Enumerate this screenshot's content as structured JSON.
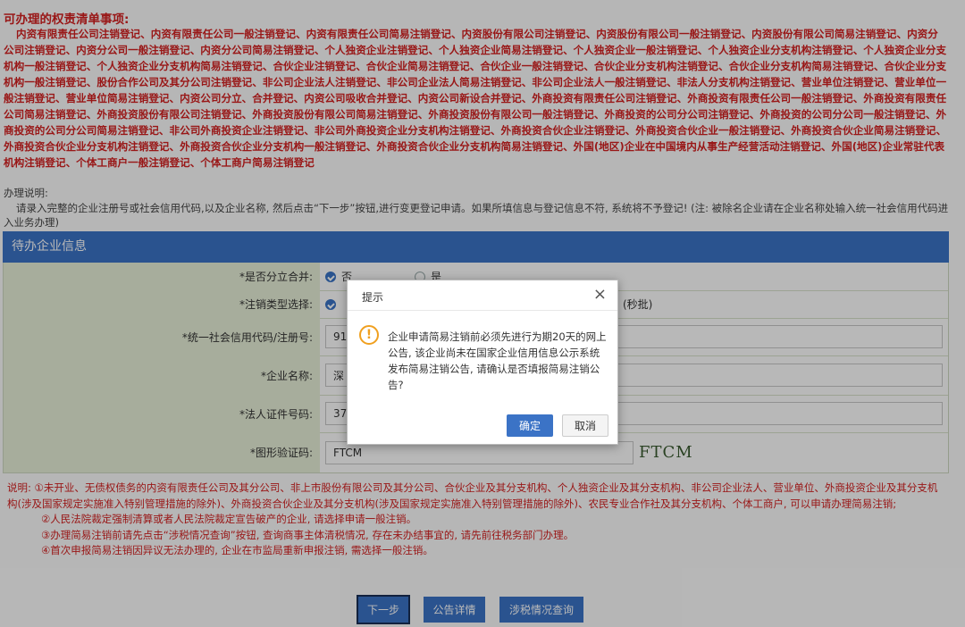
{
  "header": {
    "title": "可办理的权责清单事项:",
    "items_text": "内资有限责任公司注销登记、内资有限责任公司一般注销登记、内资有限责任公司简易注销登记、内资股份有限公司注销登记、内资股份有限公司一般注销登记、内资股份有限公司简易注销登记、内资分公司注销登记、内资分公司一般注销登记、内资分公司简易注销登记、个人独资企业注销登记、个人独资企业简易注销登记、个人独资企业一般注销登记、个人独资企业分支机构注销登记、个人独资企业分支机构一般注销登记、个人独资企业分支机构简易注销登记、合伙企业注销登记、合伙企业简易注销登记、合伙企业一般注销登记、合伙企业分支机构注销登记、合伙企业分支机构简易注销登记、合伙企业分支机构一般注销登记、股份合作公司及其分公司注销登记、非公司企业法人注销登记、非公司企业法人简易注销登记、非公司企业法人一般注销登记、非法人分支机构注销登记、营业单位注销登记、营业单位一般注销登记、营业单位简易注销登记、内资公司分立、合并登记、内资公司吸收合并登记、内资公司新设合并登记、外商投资有限责任公司注销登记、外商投资有限责任公司一般注销登记、外商投资有限责任公司简易注销登记、外商投资股份有限公司注销登记、外商投资股份有限公司简易注销登记、外商投资股份有限公司一般注销登记、外商投资的公司分公司注销登记、外商投资的公司分公司一般注销登记、外商投资的公司分公司简易注销登记、非公司外商投资企业注销登记、非公司外商投资企业分支机构注销登记、外商投资合伙企业注销登记、外商投资合伙企业一般注销登记、外商投资合伙企业简易注销登记、外商投资合伙企业分支机构注销登记、外商投资合伙企业分支机构一般注销登记、外商投资合伙企业分支机构简易注销登记、外国(地区)企业在中国境内从事生产经营活动注销登记、外国(地区)企业常驻代表机构注销登记、个体工商户一般注销登记、个体工商户简易注销登记"
  },
  "instructions": {
    "title": "办理说明:",
    "text": "请录入完整的企业注册号或社会信用代码,以及企业名称, 然后点击“下一步”按钮,进行变更登记申请。如果所填信息与登记信息不符, 系统将不予登记! (注: 被除名企业请在企业名称处输入统一社会信用代码进入业务办理)"
  },
  "section": {
    "title": "待办企业信息"
  },
  "form": {
    "split_merge": {
      "label": "*是否分立合并:",
      "options": [
        "否",
        "是"
      ],
      "selected": "否"
    },
    "cancel_type": {
      "label": "*注销类型选择:",
      "suffix": "(秒批)"
    },
    "credit_code": {
      "label": "*统一社会信用代码/注册号:",
      "value": "91"
    },
    "company_name": {
      "label": "*企业名称:",
      "value": "深"
    },
    "legal_id": {
      "label": "*法人证件号码:",
      "value": "37"
    },
    "captcha": {
      "label": "*图形验证码:",
      "value": "FTCM",
      "image_text": "FTCM"
    }
  },
  "notes": {
    "line1": "说明: ①未开业、无债权债务的内资有限责任公司及其分公司、非上市股份有限公司及其分公司、合伙企业及其分支机构、个人独资企业及其分支机构、非公司企业法人、营业单位、外商投资企业及其分支机构(涉及国家规定实施准入特别管理措施的除外)、外商投资合伙企业及其分支机构(涉及国家规定实施准入特别管理措施的除外)、农民专业合作社及其分支机构、个体工商户, 可以申请办理简易注销;",
    "line2": "②人民法院裁定强制清算或者人民法院裁定宣告破产的企业, 请选择申请一般注销。",
    "line3": "③办理简易注销前请先点击“涉税情况查询”按钮, 查询商事主体清税情况, 存在未办结事宜的, 请先前往税务部门办理。",
    "line4": "④首次申报简易注销因异议无法办理的, 企业在市监局重新申报注销, 需选择一般注销。"
  },
  "buttons": {
    "next": "下一步",
    "announcement": "公告详情",
    "tax_query": "涉税情况查询"
  },
  "dialog": {
    "title": "提示",
    "close": "×",
    "message": "企业申请简易注销前必须先进行为期20天的网上公告, 该企业尚未在国家企业信用信息公示系统发布简易注销公告, 请确认是否填报简易注销公告?",
    "ok": "确定",
    "cancel": "取消"
  },
  "colors": {
    "accent": "#3b73c6",
    "warning_red": "#d42020",
    "label_bg": "#e8f0d9",
    "warn_icon": "#f0a020"
  }
}
